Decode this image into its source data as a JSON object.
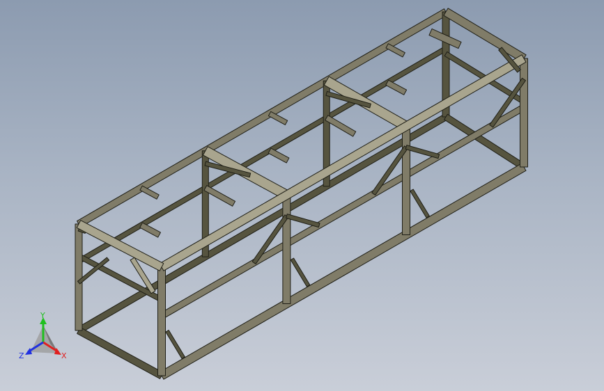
{
  "viewport": {
    "model": "steel-frame-weldment"
  },
  "triad": {
    "x_label": "X",
    "y_label": "Y",
    "z_label": "Z",
    "x_color": "#e02020",
    "y_color": "#20c020",
    "z_color": "#2030e0"
  },
  "colors": {
    "steel_face": "#807c68",
    "steel_dark": "#56543f",
    "steel_light": "#a9a58e",
    "edge": "#1e1e16"
  }
}
